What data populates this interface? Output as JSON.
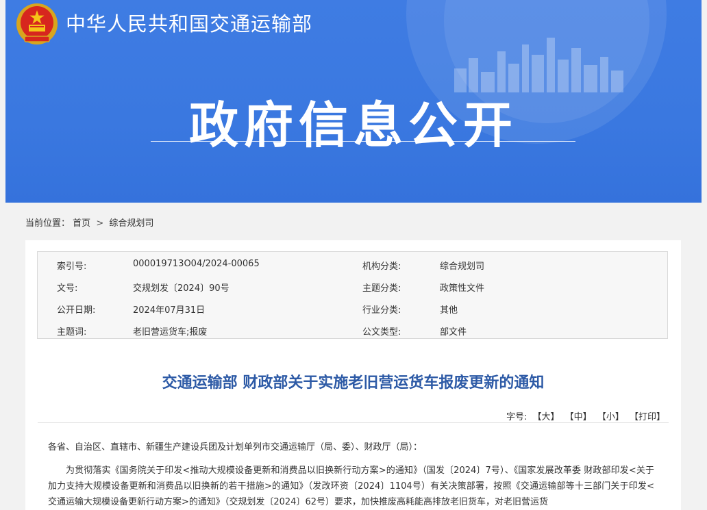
{
  "header": {
    "ministry_name": "中华人民共和国交通运输部",
    "banner_title": "政府信息公开"
  },
  "breadcrumb": {
    "prefix": "当前位置：",
    "items": [
      "首页",
      "综合规划司"
    ],
    "separator": ">"
  },
  "meta": {
    "rows": [
      {
        "label1": "索引号:",
        "value1": "000019713O04/2024-00065",
        "label2": "机构分类:",
        "value2": "综合规划司"
      },
      {
        "label1": "文号:",
        "value1": "交规划发〔2024〕90号",
        "label2": "主题分类:",
        "value2": "政策性文件"
      },
      {
        "label1": "公开日期:",
        "value1": "2024年07月31日",
        "label2": "行业分类:",
        "value2": "其他"
      },
      {
        "label1": "主题词:",
        "value1": "老旧营运货车;报废",
        "label2": "公文类型:",
        "value2": "部文件"
      }
    ]
  },
  "document": {
    "title": "交通运输部 财政部关于实施老旧营运货车报废更新的通知",
    "font_label": "字号:",
    "font_large": "【大】",
    "font_medium": "【中】",
    "font_small": "【小】",
    "print": "【打印】",
    "greeting": "各省、自治区、直辖市、新疆生产建设兵团及计划单列市交通运输厅（局、委）、财政厅（局）：",
    "paragraph": "为贯彻落实《国务院关于印发<推动大规模设备更新和消费品以旧换新行动方案>的通知》（国发〔2024〕7号）、《国家发展改革委 财政部印发<关于加力支持大规模设备更新和消费品以旧换新的若干措施>的通知》（发改环资〔2024〕1104号）有关决策部署，按照《交通运输部等十三部门关于印发<交通运输大规模设备更新行动方案>的通知》（交规划发〔2024〕62号）要求，加快推废高耗能高排放老旧货车，对老旧营运货"
  },
  "colors": {
    "banner": "#3a78e0",
    "title": "#2d5aa6",
    "page_bg": "#f2f2f2"
  }
}
